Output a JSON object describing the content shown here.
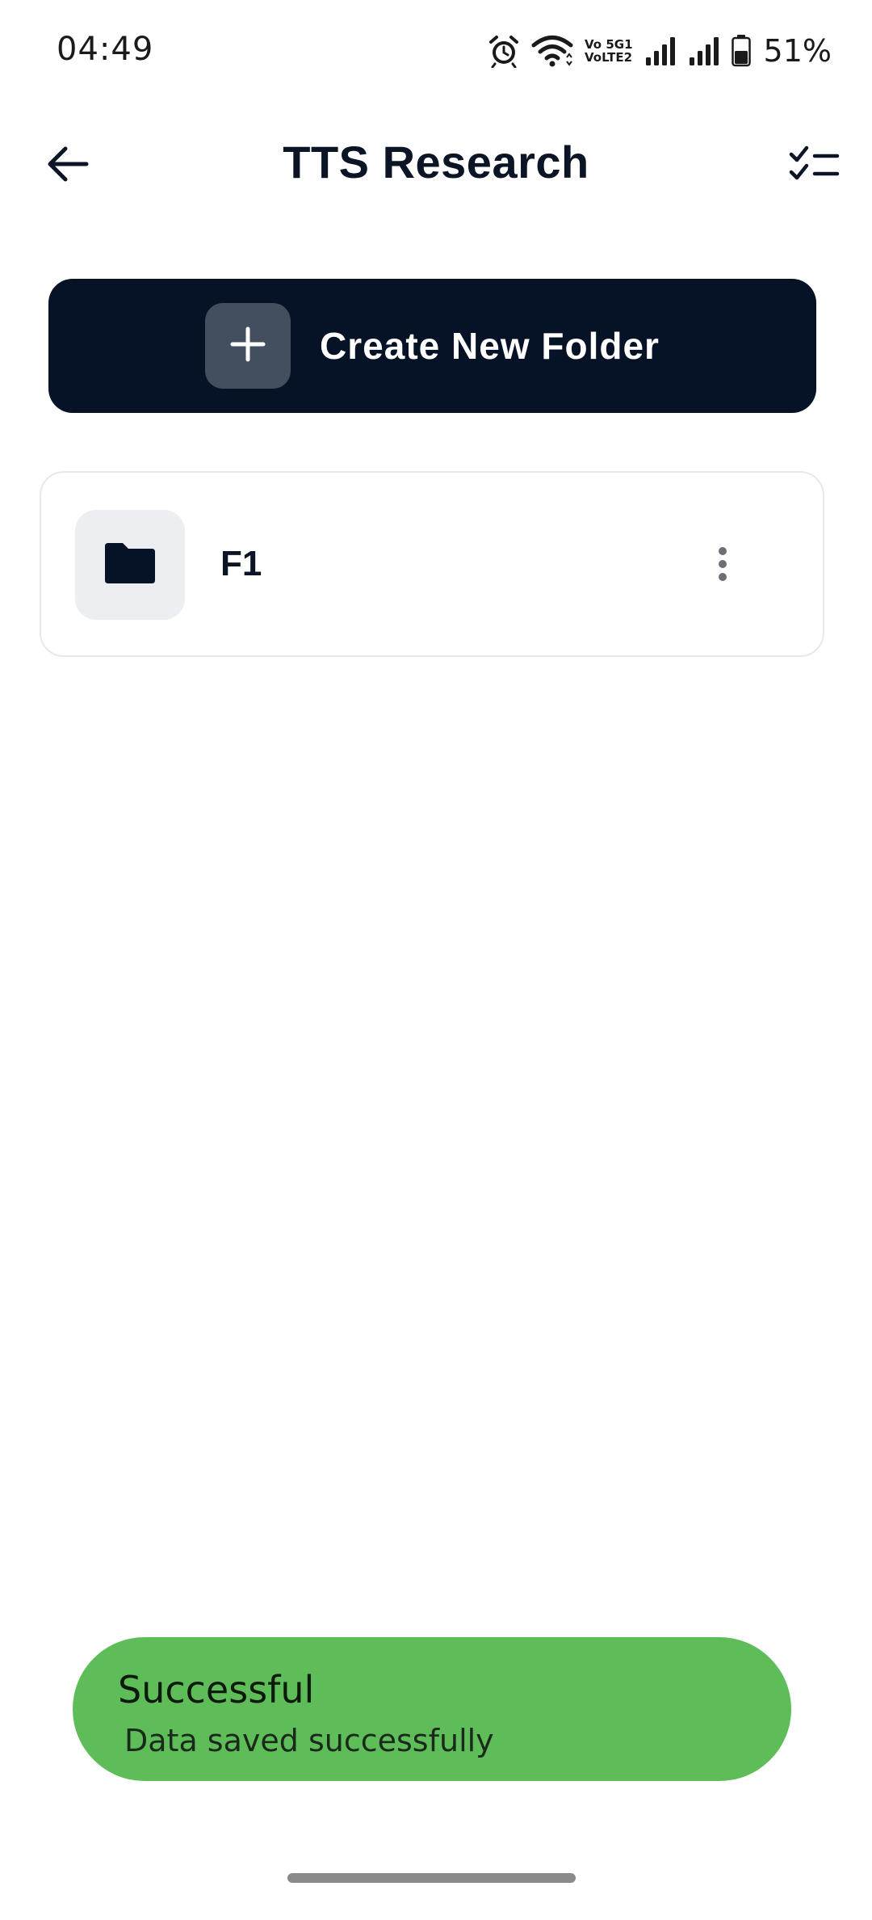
{
  "status_bar": {
    "time": "04:49",
    "battery_percent": "51%",
    "network_label_top": "Vo 5G1",
    "network_label_bottom": "VoLTE2",
    "icons": [
      "alarm-icon",
      "wifi-icon",
      "volte-icon",
      "signal-1-icon",
      "signal-2-icon",
      "battery-icon"
    ]
  },
  "header": {
    "title": "TTS Research",
    "back_icon": "arrow-left-icon",
    "select_icon": "checklist-icon"
  },
  "create_button": {
    "label": "Create New Folder",
    "icon": "plus-icon"
  },
  "folders": [
    {
      "name": "F1",
      "icon": "folder-icon",
      "menu_icon": "more-vertical-icon"
    }
  ],
  "toast": {
    "title": "Successful",
    "message": "Data saved successfully",
    "color": "#5ebd58"
  },
  "colors": {
    "primary_dark": "#061226",
    "plus_box": "#434f5f",
    "folder_icon_bg": "#eceef1",
    "card_border": "#e6e8eb"
  }
}
